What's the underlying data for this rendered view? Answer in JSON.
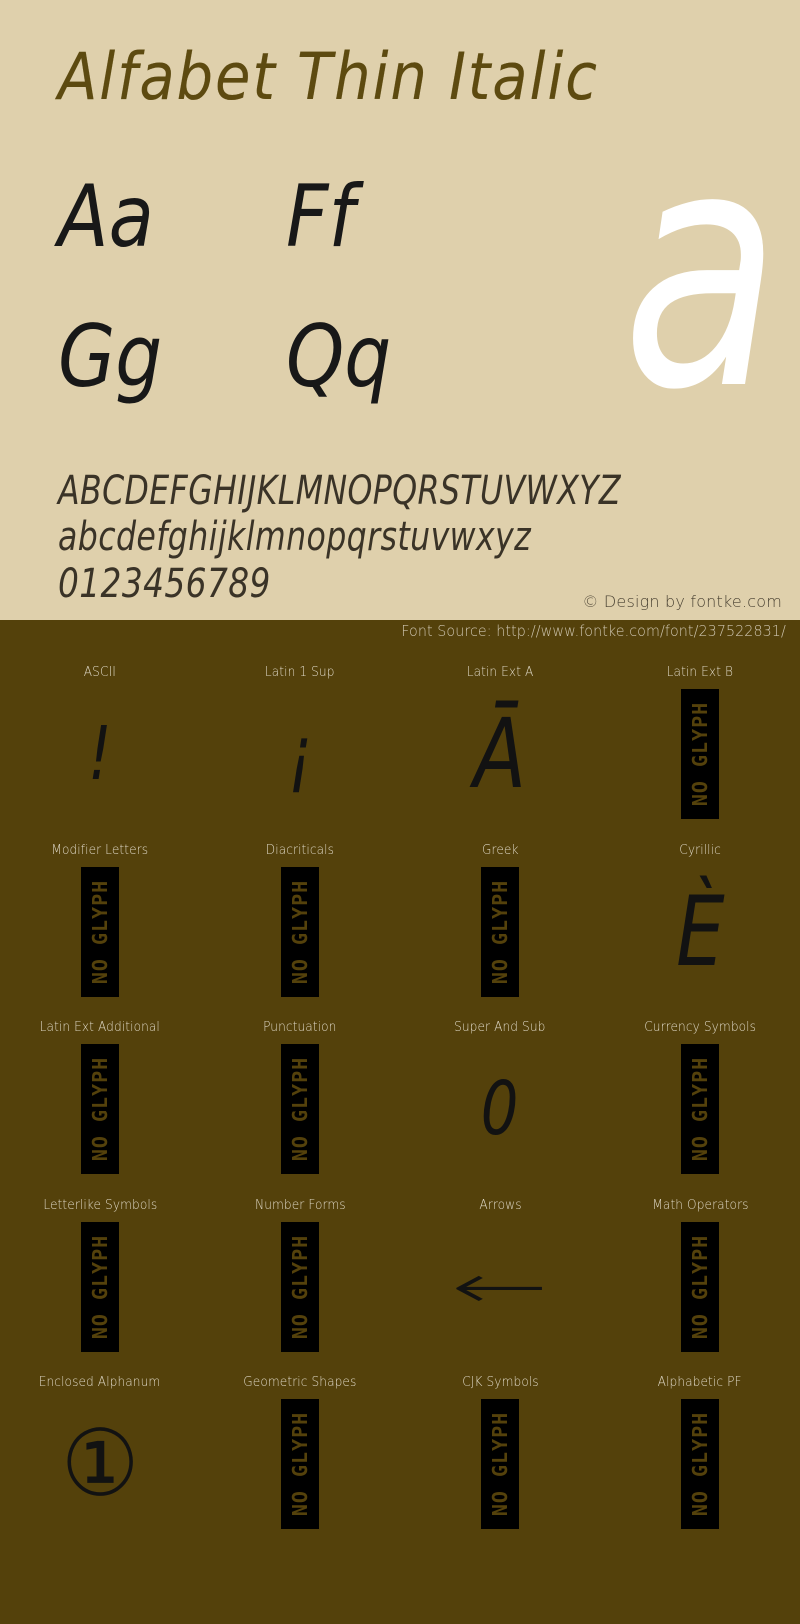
{
  "top_panel": {
    "title": "Alfabet Thin Italic",
    "hero_glyph": "a",
    "letter_pairs": [
      [
        "Aa",
        "Ff"
      ],
      [
        "Gg",
        "Qq"
      ]
    ],
    "alphabet": {
      "uppercase": "ABCDEFGHIJKLMNOPQRSTUVWXYZ",
      "lowercase": "abcdefghijklmnopqrstuvwxyz",
      "digits": "0123456789"
    },
    "credit": "© Design by fontke.com",
    "colors": {
      "background": "#dfd0ac",
      "title": "#5d4a10",
      "glyph": "#181818",
      "hero": "#ffffff"
    }
  },
  "bottom_panel": {
    "font_source": "Font Source: http://www.fontke.com/font/237522831/",
    "no_glyph_text": "NO GLYPH",
    "colors": {
      "background": "#54410b",
      "label": "#ddd6c4",
      "glyph": "#121212",
      "badge": "#000000"
    },
    "blocks": [
      {
        "label": "ASCII",
        "glyph": "!",
        "has_glyph": true,
        "style": "small"
      },
      {
        "label": "Latin 1 Sup",
        "glyph": "¡",
        "has_glyph": true,
        "style": "small"
      },
      {
        "label": "Latin Ext A",
        "glyph": "Ā",
        "has_glyph": true,
        "style": "normal"
      },
      {
        "label": "Latin Ext B",
        "glyph": "",
        "has_glyph": false,
        "style": "normal"
      },
      {
        "label": "Modifier Letters",
        "glyph": "",
        "has_glyph": false,
        "style": "normal"
      },
      {
        "label": "Diacriticals",
        "glyph": "",
        "has_glyph": false,
        "style": "normal"
      },
      {
        "label": "Greek",
        "glyph": "",
        "has_glyph": false,
        "style": "normal"
      },
      {
        "label": "Cyrillic",
        "glyph": "È",
        "has_glyph": true,
        "style": "normal"
      },
      {
        "label": "Latin Ext Additional",
        "glyph": "",
        "has_glyph": false,
        "style": "normal"
      },
      {
        "label": "Punctuation",
        "glyph": "",
        "has_glyph": false,
        "style": "normal"
      },
      {
        "label": "Super And Sub",
        "glyph": "0",
        "has_glyph": true,
        "style": "small"
      },
      {
        "label": "Currency Symbols",
        "glyph": "",
        "has_glyph": false,
        "style": "normal"
      },
      {
        "label": "Letterlike Symbols",
        "glyph": "",
        "has_glyph": false,
        "style": "normal"
      },
      {
        "label": "Number Forms",
        "glyph": "",
        "has_glyph": false,
        "style": "normal"
      },
      {
        "label": "Arrows",
        "glyph": "←",
        "has_glyph": true,
        "style": "arrow"
      },
      {
        "label": "Math Operators",
        "glyph": "",
        "has_glyph": false,
        "style": "normal"
      },
      {
        "label": "Enclosed Alphanum",
        "glyph": "①",
        "has_glyph": true,
        "style": "circled"
      },
      {
        "label": "Geometric Shapes",
        "glyph": "",
        "has_glyph": false,
        "style": "normal"
      },
      {
        "label": "CJK Symbols",
        "glyph": "",
        "has_glyph": false,
        "style": "normal"
      },
      {
        "label": "Alphabetic PF",
        "glyph": "",
        "has_glyph": false,
        "style": "normal"
      }
    ]
  }
}
